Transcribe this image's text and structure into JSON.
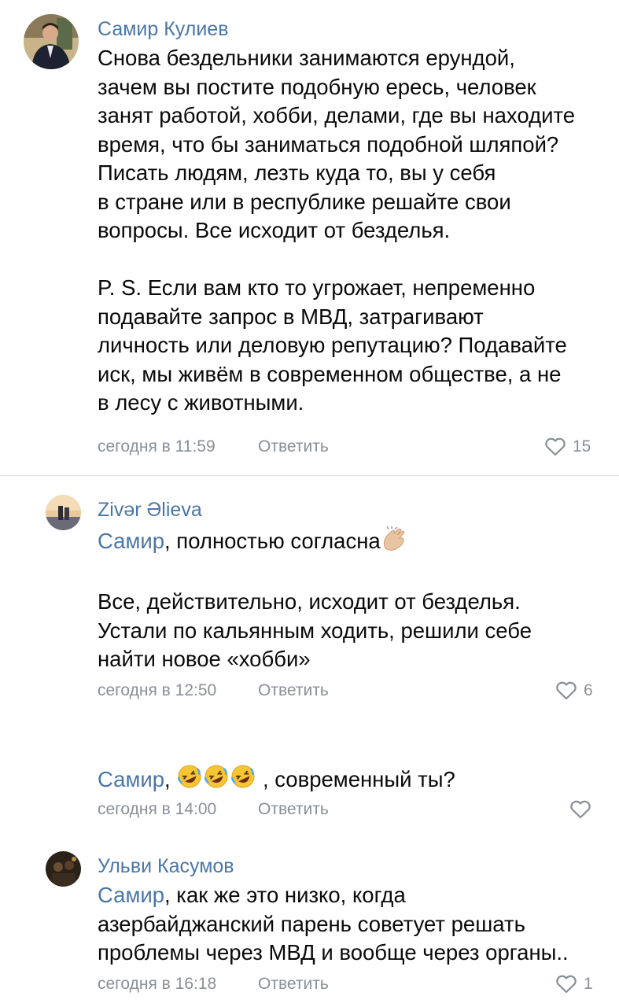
{
  "comments": [
    {
      "author": "Самир Кулиев",
      "text": "Снова бездельники занимаются ерундой,\nзачем вы постите подобную ересь, человек\nзанят работой, хобби, делами, где вы находите\nвремя, что бы заниматься подобной шляпой?\nПисать людям, лезть куда то, вы у себя\nв стране или в республике решайте свои\nвопросы. Все исходит от безделья.\n\nP. S. Если вам кто то угрожает, непременно\nподавайте запрос в МВД, затрагивают\nличность или деловую репутацию? Подавайте\nиск, мы живём в современном обществе, а не\nв лесу с животными.",
      "time": "сегодня в 11:59",
      "reply": "Ответить",
      "likes": "15"
    },
    {
      "author": "Zivər Əlieva",
      "mention": "Самир",
      "text_after_mention": ", полностью согласна",
      "emoji": "clapping-hands-icon",
      "text_2": "Все, действительно, исходит от безделья.\nУстали по кальянным ходить, решили себе\nнайти новое «хобби»",
      "time": "сегодня в 12:50",
      "reply": "Ответить",
      "likes": "6"
    },
    {
      "mention": "Самир",
      "text_before_emoji": ",",
      "emoji": "rofl-face-icon",
      "text_after_emoji": ", современный ты?",
      "time": "сегодня в 14:00",
      "reply": "Ответить",
      "likes": ""
    },
    {
      "author": "Ульви Касумов",
      "mention": "Самир",
      "text_after_mention": ", как же это низко, когда\nазербайджанский парень советует решать\nпроблемы через МВД и вообще через органы..",
      "time": "сегодня в 16:18",
      "reply": "Ответить",
      "likes": "1"
    }
  ],
  "colors": {
    "link": "#4a76a8",
    "meta": "#8a8f96",
    "divider": "#dfe1e5"
  }
}
